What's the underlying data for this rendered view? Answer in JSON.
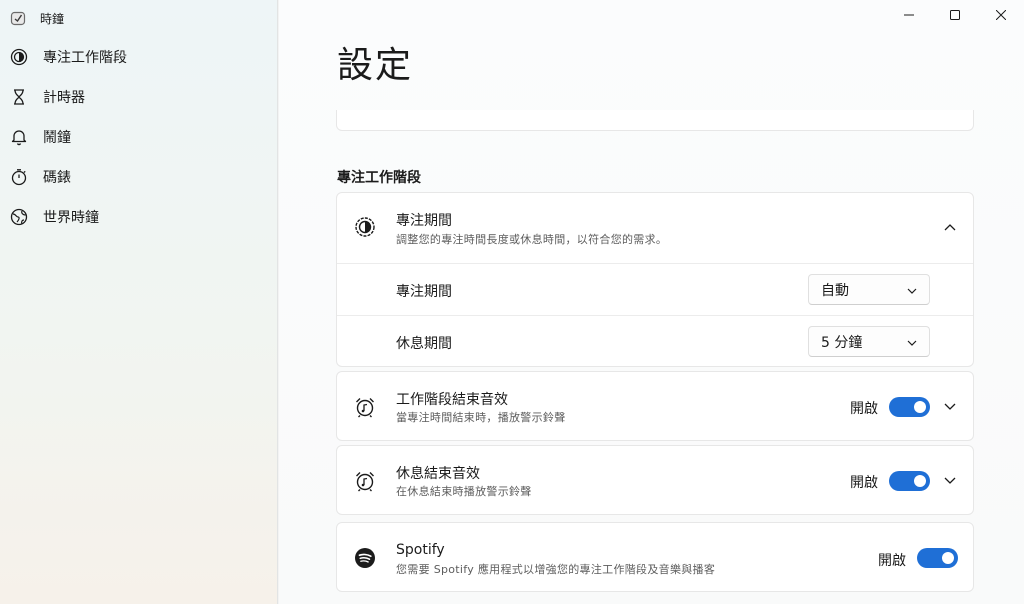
{
  "app": {
    "title": "時鐘"
  },
  "sidebar": {
    "items": [
      {
        "label": "專注工作階段",
        "icon": "focus-icon"
      },
      {
        "label": "計時器",
        "icon": "hourglass-icon"
      },
      {
        "label": "鬧鐘",
        "icon": "bell-icon"
      },
      {
        "label": "碼錶",
        "icon": "stopwatch-icon"
      },
      {
        "label": "世界時鐘",
        "icon": "globe-icon"
      }
    ]
  },
  "page": {
    "title": "設定"
  },
  "focus_section": {
    "title": "專注工作階段",
    "focus_period": {
      "title": "專注期間",
      "description": "調整您的專注時間長度或休息時間，以符合您的需求。",
      "expanded": true,
      "rows": [
        {
          "label": "專注期間",
          "value": "自動"
        },
        {
          "label": "休息期間",
          "value": "5 分鐘"
        }
      ]
    },
    "end_sound": {
      "title": "工作階段結束音效",
      "description": "當專注時間結束時，播放警示鈴聲",
      "toggle_label": "開啟",
      "enabled": true
    },
    "break_sound": {
      "title": "休息結束音效",
      "description": "在休息結束時播放警示鈴聲",
      "toggle_label": "開啟",
      "enabled": true
    },
    "spotify": {
      "title": "Spotify",
      "description": "您需要 Spotify 應用程式以增強您的專注工作階段及音樂與播客",
      "toggle_label": "開啟",
      "enabled": true
    }
  },
  "colors": {
    "accent": "#1f6fd6",
    "text": "#1b1b1b",
    "secondary_text": "#5d5d5d"
  }
}
